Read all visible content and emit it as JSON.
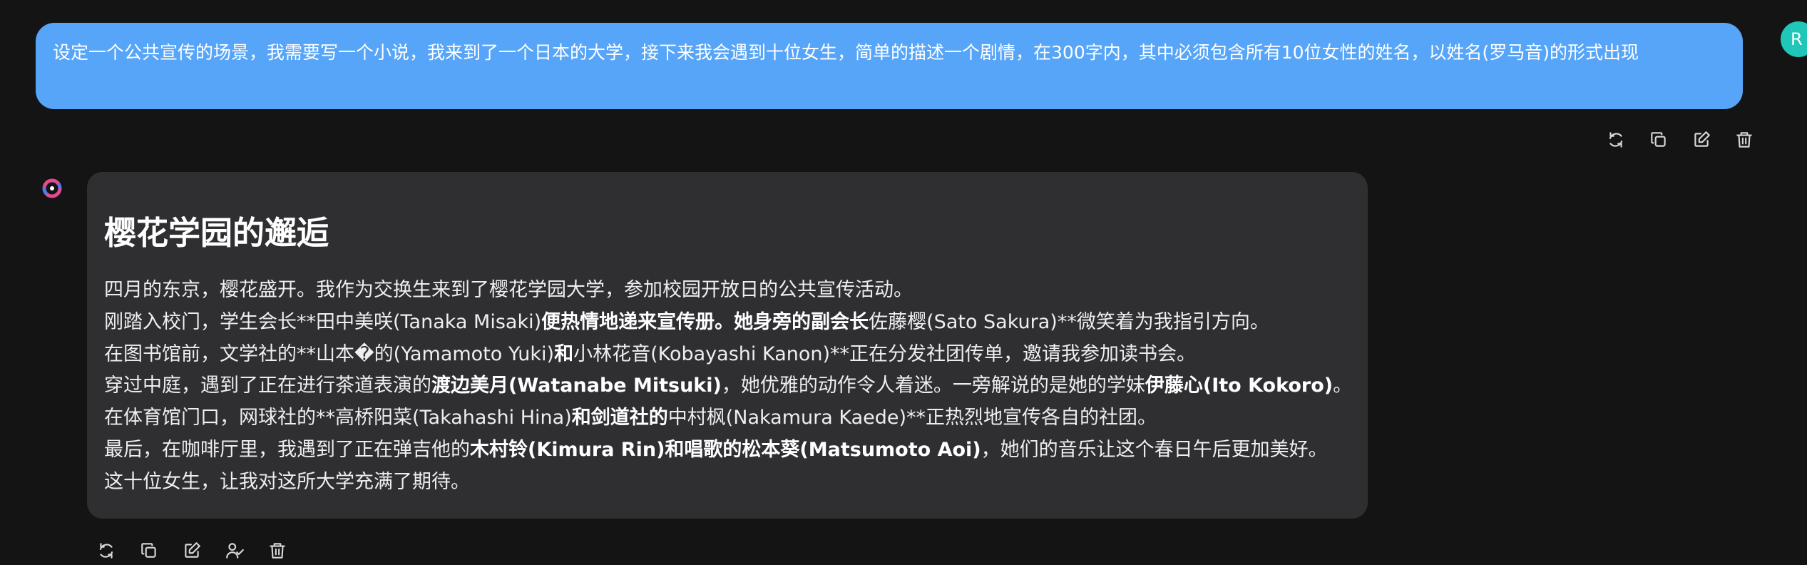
{
  "user_message": {
    "text": "设定一个公共宣传的场景，我需要写一个小说，我来到了一个日本的大学，接下来我会遇到十位女生，简单的描述一个剧情，在300字内，其中必须包含所有10位女性的姓名，以姓名(罗马音)的形式出现",
    "avatar_letter": "R"
  },
  "user_actions": [
    {
      "icon": "refresh-icon",
      "name": "regenerate-button"
    },
    {
      "icon": "copy-icon",
      "name": "copy-button"
    },
    {
      "icon": "edit-icon",
      "name": "edit-button"
    },
    {
      "icon": "trash-icon",
      "name": "delete-button"
    }
  ],
  "assistant_message": {
    "title": "樱花学园的邂逅",
    "paragraphs": [
      [
        {
          "t": "四月的东京，樱花盛开。我作为交换生来到了樱花学园大学，参加校园开放日的公共宣传活动。",
          "b": false
        }
      ],
      [
        {
          "t": "刚踏入校门，学生会长**田中美咲(Tanaka Misaki)",
          "b": false
        },
        {
          "t": "便热情地递来宣传册。她身旁的副会长",
          "b": true
        },
        {
          "t": "佐藤樱(Sato Sakura)**微笑着为我指引方向。",
          "b": false
        }
      ],
      [
        {
          "t": "在图书馆前，文学社的**山本�的(Yamamoto Yuki)",
          "b": false
        },
        {
          "t": "和",
          "b": true
        },
        {
          "t": "小林花音(Kobayashi Kanon)**正在分发社团传单，邀请我参加读书会。",
          "b": false
        }
      ],
      [
        {
          "t": "穿过中庭，遇到了正在进行茶道表演的",
          "b": false
        },
        {
          "t": "渡边美月(Watanabe Mitsuki)",
          "b": true
        },
        {
          "t": "，她优雅的动作令人着迷。一旁解说的是她的学妹",
          "b": false
        },
        {
          "t": "伊藤心(Ito Kokoro)",
          "b": true
        },
        {
          "t": "。",
          "b": false
        }
      ],
      [
        {
          "t": "在体育馆门口，网球社的**高桥阳菜(Takahashi Hina)",
          "b": false
        },
        {
          "t": "和剑道社的",
          "b": true
        },
        {
          "t": "中村枫(Nakamura Kaede)**正热烈地宣传各自的社团。",
          "b": false
        }
      ],
      [
        {
          "t": "最后，在咖啡厅里，我遇到了正在弹吉他的",
          "b": false
        },
        {
          "t": "木村铃(Kimura Rin)和唱歌的松本葵(Matsumoto Aoi)",
          "b": true
        },
        {
          "t": "，她们的音乐让这个春日午后更加美好。",
          "b": false
        }
      ],
      [
        {
          "t": "这十位女生，让我对这所大学充满了期待。",
          "b": false
        }
      ]
    ]
  },
  "assistant_actions": [
    {
      "icon": "refresh-icon",
      "name": "regenerate-button"
    },
    {
      "icon": "copy-icon",
      "name": "copy-button"
    },
    {
      "icon": "edit-icon",
      "name": "edit-button"
    },
    {
      "icon": "user-check-icon",
      "name": "select-persona-button"
    },
    {
      "icon": "trash-icon",
      "name": "delete-button"
    }
  ],
  "colors": {
    "background": "#141415",
    "user_bubble": "#57a5f8",
    "assistant_card": "#2f2f32",
    "user_avatar": "#20c7b8"
  }
}
